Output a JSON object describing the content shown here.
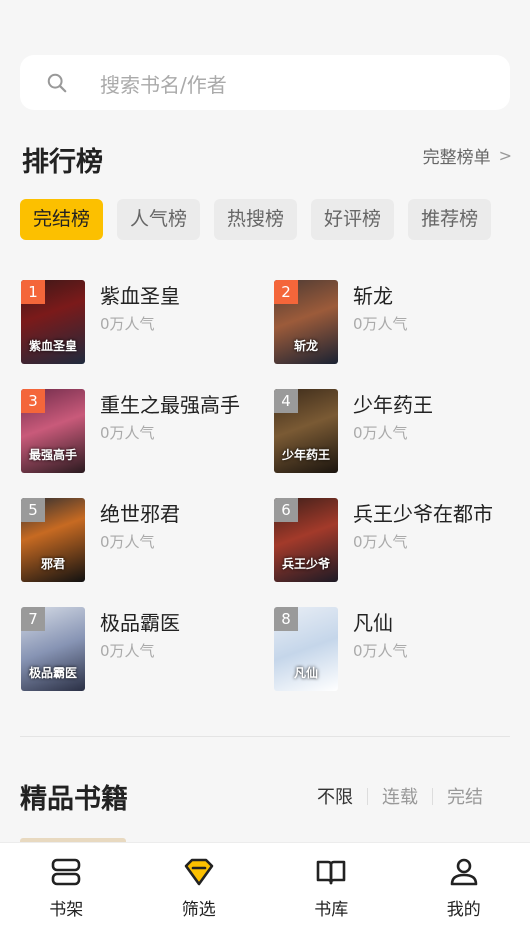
{
  "search": {
    "placeholder": "搜索书名/作者"
  },
  "ranking": {
    "title": "排行榜",
    "more_label": "完整榜单",
    "tabs": [
      "完结榜",
      "人气榜",
      "热搜榜",
      "好评榜",
      "推荐榜"
    ],
    "active_tab": "完结榜",
    "books": [
      {
        "rank": "1",
        "name": "紫血圣皇",
        "popularity": "0万人气",
        "cover_text": "紫血圣皇",
        "badge_color": "#f4663a",
        "cover_bg": "linear-gradient(160deg,#3a1818,#7b1a1a 40%,#1f2a3d)"
      },
      {
        "rank": "2",
        "name": "斩龙",
        "popularity": "0万人气",
        "cover_text": "斩龙",
        "badge_color": "#f4663a",
        "cover_bg": "linear-gradient(160deg,#4b3a34,#9c5b3a 45%,#1a2233)"
      },
      {
        "rank": "3",
        "name": "重生之最强高手",
        "popularity": "0万人气",
        "cover_text": "最强高手",
        "badge_color": "#f4663a",
        "cover_bg": "linear-gradient(160deg,#6e2b4a,#c95a7a 45%,#2a1a1f)"
      },
      {
        "rank": "4",
        "name": "少年药王",
        "popularity": "0万人气",
        "cover_text": "少年药王",
        "badge_color": "#9a9a9a",
        "cover_bg": "linear-gradient(160deg,#3b2a1a,#7a5a34 45%,#1a140e)"
      },
      {
        "rank": "5",
        "name": "绝世邪君",
        "popularity": "0万人气",
        "cover_text": "邪君",
        "badge_color": "#9a9a9a",
        "cover_bg": "linear-gradient(160deg,#2a2d33,#c76a22 40%,#111)"
      },
      {
        "rank": "6",
        "name": "兵王少爷在都市",
        "popularity": "0万人气",
        "cover_text": "兵王少爷",
        "badge_color": "#9a9a9a",
        "cover_bg": "linear-gradient(160deg,#3b1f1a,#a33a2a 45%,#1d1a25)"
      },
      {
        "rank": "7",
        "name": "极品霸医",
        "popularity": "0万人气",
        "cover_text": "极品霸医",
        "badge_color": "#9a9a9a",
        "cover_bg": "linear-gradient(160deg,#d6dce6,#8794b4 50%,#2a2f44)"
      },
      {
        "rank": "8",
        "name": "凡仙",
        "popularity": "0万人气",
        "cover_text": "凡仙",
        "badge_color": "#9a9a9a",
        "cover_bg": "linear-gradient(160deg,#e9eef5,#c5d6ea 50%,#ffffff)"
      }
    ]
  },
  "premium": {
    "title": "精品书籍",
    "filters": [
      "不限",
      "连载",
      "完结"
    ],
    "active_filter": "不限"
  },
  "tabbar": {
    "items": [
      {
        "label": "书架",
        "icon": "bookshelf-icon"
      },
      {
        "label": "筛选",
        "icon": "diamond-filter-icon"
      },
      {
        "label": "书库",
        "icon": "open-book-icon"
      },
      {
        "label": "我的",
        "icon": "user-icon"
      }
    ]
  },
  "colors": {
    "accent": "#fcc000",
    "background": "#f6f6f6"
  }
}
